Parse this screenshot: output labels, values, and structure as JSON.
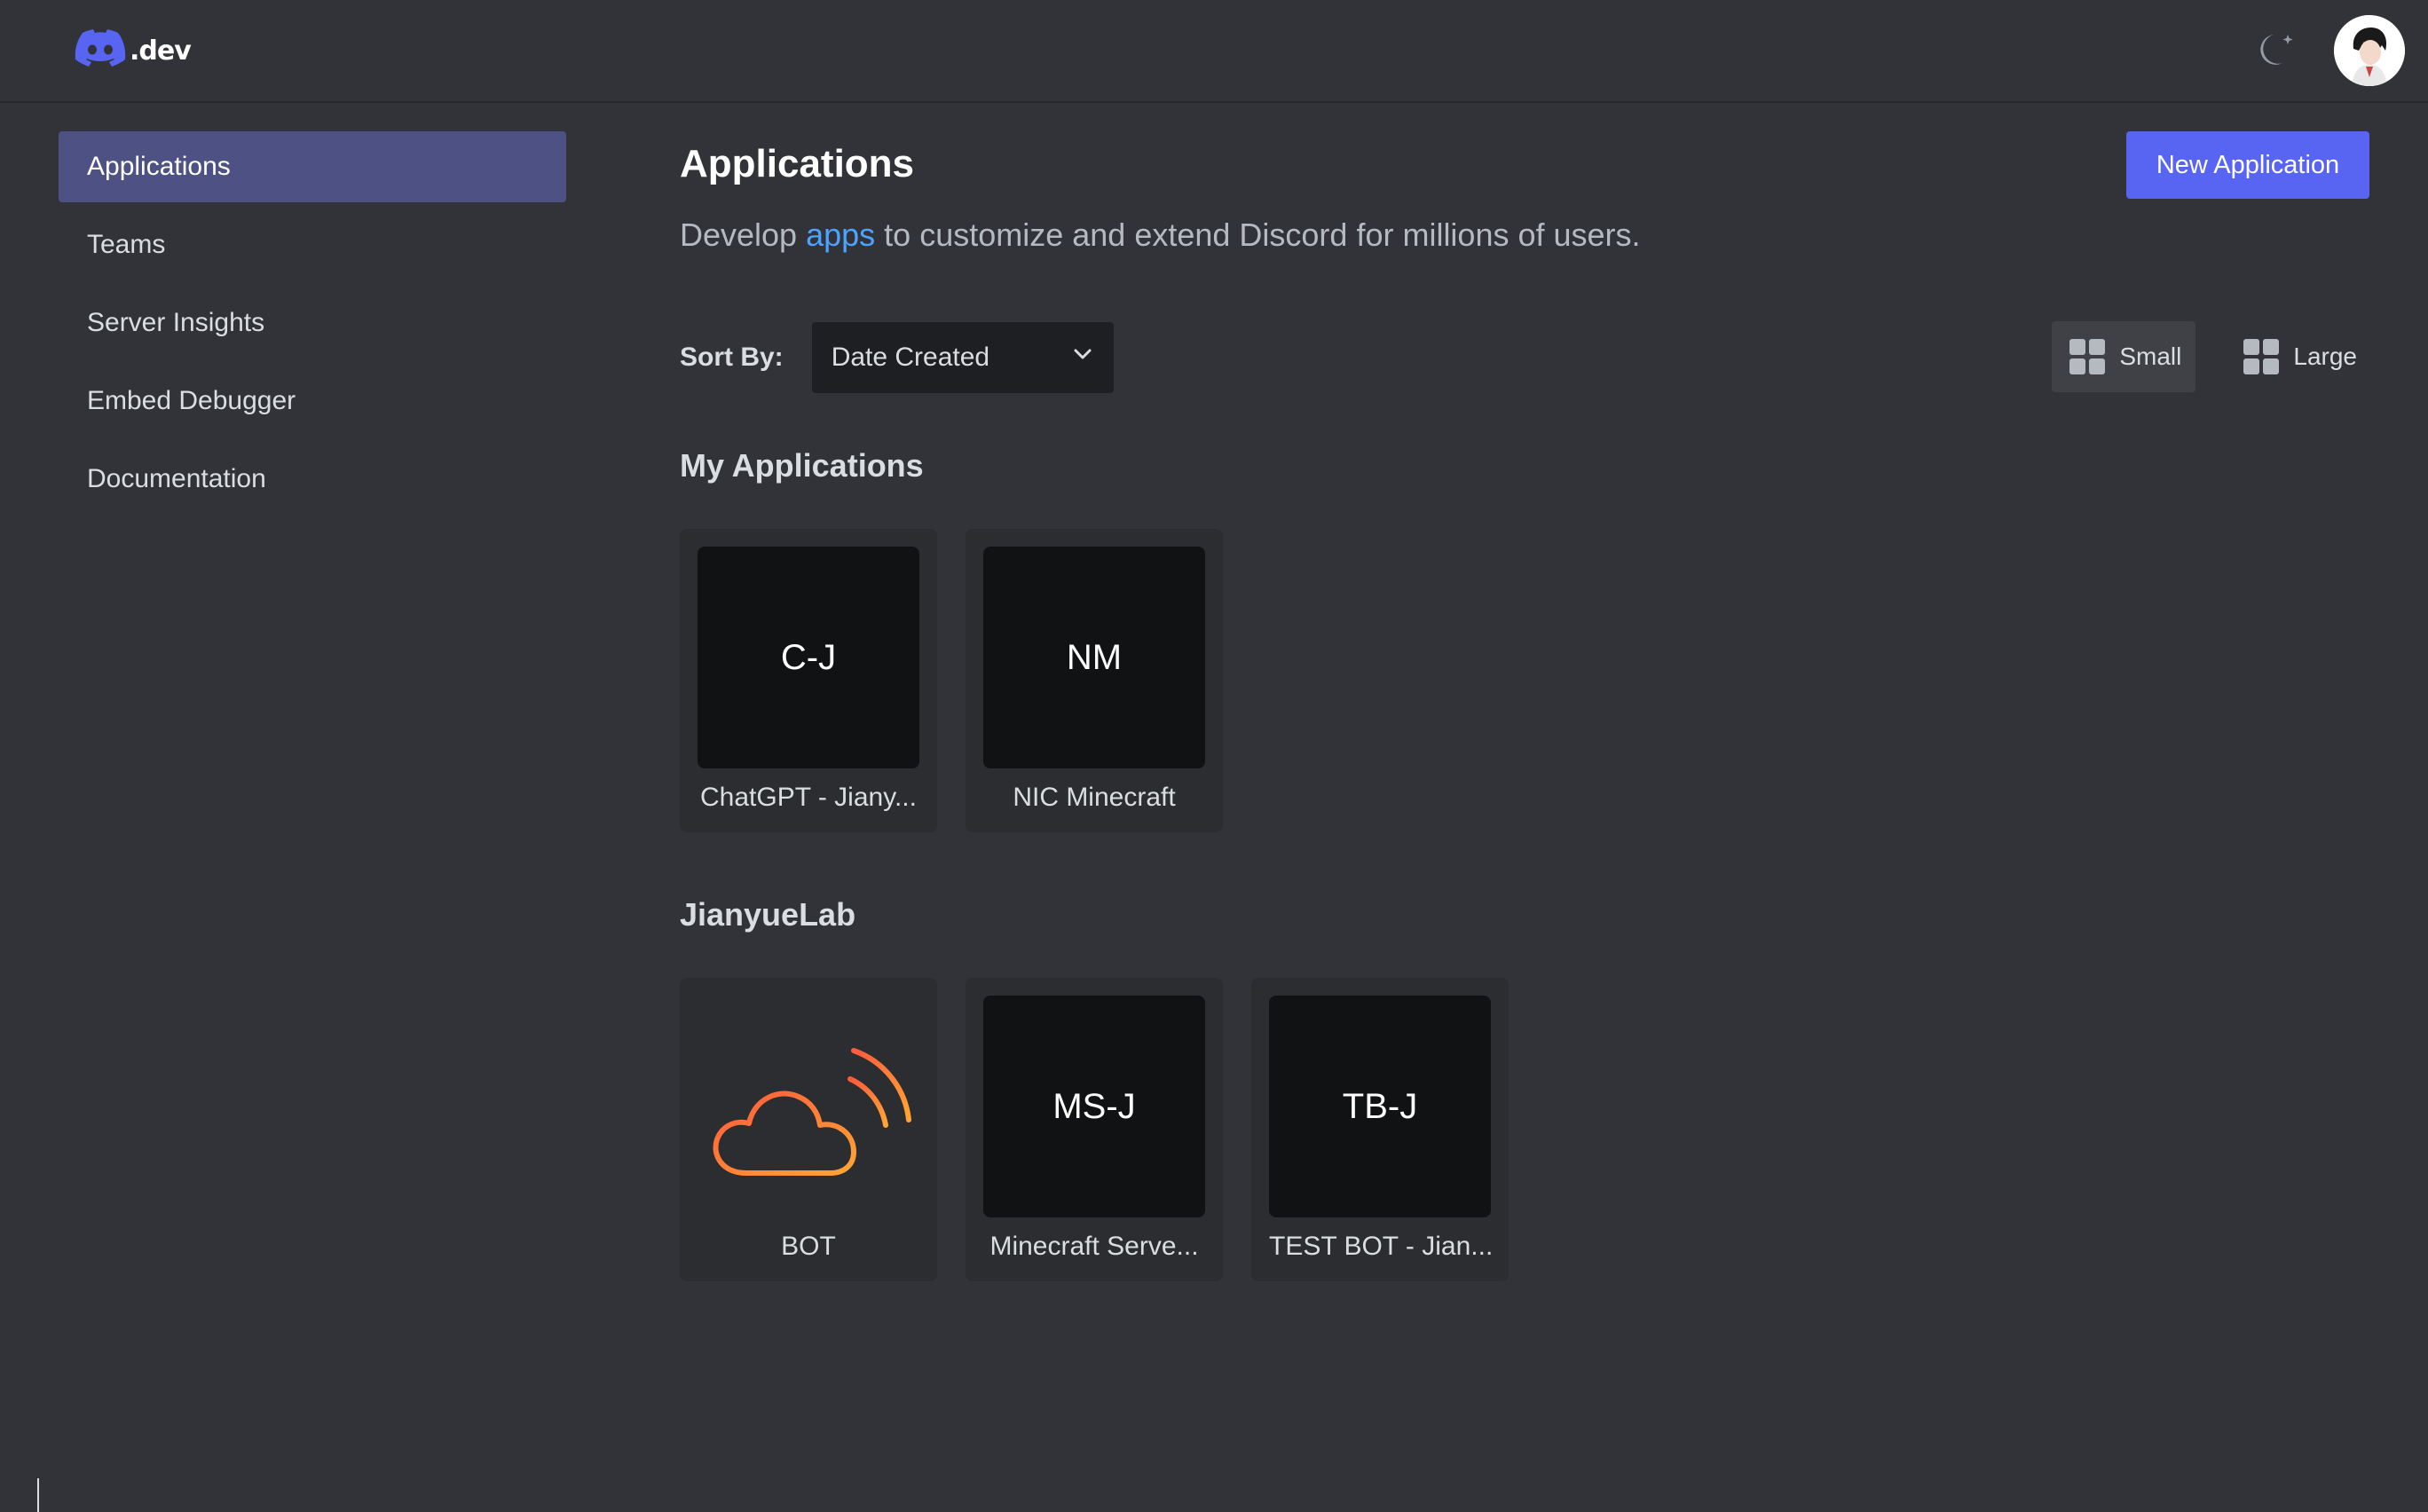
{
  "header": {
    "logo_text": ".dev",
    "theme_icon": "moon-sparkle-icon",
    "avatar_icon": "user-avatar"
  },
  "sidebar": {
    "items": [
      {
        "label": "Applications",
        "active": true
      },
      {
        "label": "Teams"
      },
      {
        "label": "Server Insights"
      },
      {
        "label": "Embed Debugger"
      },
      {
        "label": "Documentation"
      }
    ]
  },
  "main": {
    "title": "Applications",
    "new_app_label": "New Application",
    "subtitle_before": "Develop ",
    "subtitle_link": "apps",
    "subtitle_after": " to customize and extend Discord for millions of users.",
    "sort_label": "Sort By:",
    "sort_value": "Date Created",
    "view_small": "Small",
    "view_large": "Large",
    "sections": [
      {
        "title": "My Applications",
        "apps": [
          {
            "initials": "C-J",
            "name": "ChatGPT - Jiany..."
          },
          {
            "initials": "NM",
            "name": "NIC Minecraft"
          }
        ]
      },
      {
        "title": "JianyueLab",
        "apps": [
          {
            "initials": "",
            "name": "BOT",
            "icon": "cloud-signal-icon"
          },
          {
            "initials": "MS-J",
            "name": "Minecraft Serve..."
          },
          {
            "initials": "TB-J",
            "name": "TEST BOT - Jian..."
          }
        ]
      }
    ]
  },
  "colors": {
    "background": "#313338",
    "accent": "#5865f2",
    "active_nav": "#4e5184",
    "link": "#4da3ff",
    "card_bg": "#2b2d31",
    "icon_bg": "#111214"
  }
}
